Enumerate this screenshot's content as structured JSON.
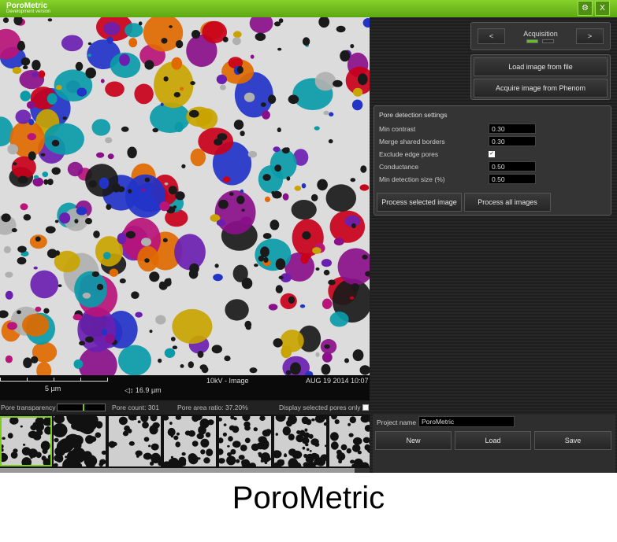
{
  "titlebar": {
    "title": "PoroMetric",
    "subtitle": "Development version",
    "settings_icon": "gears-icon",
    "close_label": "X"
  },
  "image_info": {
    "scale_label": "5 µm",
    "fov_label": "16.9 µm",
    "kv_label": "10kV - Image",
    "date_label": "AUG 19 2014 10:07"
  },
  "status": {
    "transparency_label": "Pore transparency",
    "transparency_value": 0.55,
    "pore_count": "Pore count: 301",
    "pore_area_ratio": "Pore area ratio: 37.20%",
    "display_selected_label": "Display selected pores only"
  },
  "acquisition": {
    "title": "Acquisition",
    "prev_label": "<",
    "next_label": ">",
    "active_color": "#5ec21a"
  },
  "load_buttons": {
    "load_file": "Load image from file",
    "acquire_phenom": "Acquire image from Phenom"
  },
  "pore_detection": {
    "title": "Pore detection settings",
    "min_contrast_label": "Min contrast",
    "min_contrast_value": "0.30",
    "merge_borders_label": "Merge shared borders",
    "merge_borders_value": "0.30",
    "exclude_edge_label": "Exclude edge pores",
    "exclude_edge_checked": "✓",
    "conductance_label": "Conductance",
    "conductance_value": "0.50",
    "min_size_label": "Min detection size (%)",
    "min_size_value": "0.50",
    "process_selected": "Process selected image",
    "process_all": "Process all images"
  },
  "project": {
    "name_label": "Project name",
    "name_value": "PoroMetric",
    "new_label": "New",
    "load_label": "Load",
    "save_label": "Save"
  },
  "caption": "PoroMetric"
}
